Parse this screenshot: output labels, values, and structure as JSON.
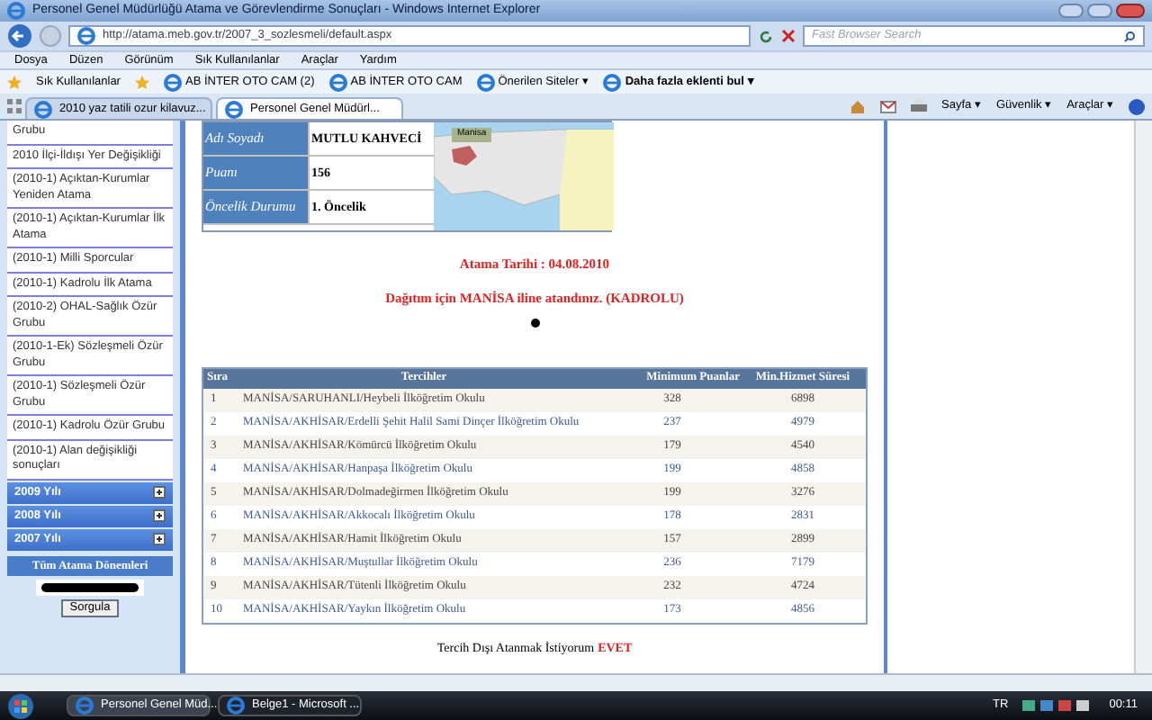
{
  "window": {
    "title": "Personel Genel Müdürlüğü Atama ve Görevlendirme Sonuçları - Windows Internet Explorer"
  },
  "address_bar": {
    "url": "http://atama.meb.gov.tr/2007_3_sozlesmeli/default.aspx"
  },
  "search": {
    "placeholder": "Fast Browser Search"
  },
  "menu": [
    "Dosya",
    "Düzen",
    "Görünüm",
    "Sık Kullanılanlar",
    "Araçlar",
    "Yardım"
  ],
  "favorites_bar": {
    "label": "Sık Kullanılanlar",
    "links": [
      {
        "label": "AB İNTER OTO CAM (2)",
        "kind": "page"
      },
      {
        "label": "AB İNTER OTO CAM",
        "kind": "page"
      },
      {
        "label": "Önerilen Siteler ▾",
        "kind": "page"
      },
      {
        "label": "Daha fazla eklenti bul ▾",
        "kind": "bold"
      }
    ]
  },
  "tabs": [
    {
      "label": "2010 yaz tatili ozur kilavuz...",
      "selected": false
    },
    {
      "label": "Personel Genel Müdürl...",
      "selected": true
    }
  ],
  "command_bar": [
    "Sayfa ▾",
    "Güvenlik ▾",
    "Araçlar ▾"
  ],
  "sidebar": {
    "items": [
      "Grubu",
      "2010 İlçi-İldışı Yer Değişikliği",
      "(2010-1) Açıktan-Kurumlar Yeniden Atama",
      "(2010-1) Açıktan-Kurumlar İlk Atama",
      "(2010-1) Milli Sporcular",
      "(2010-1) Kadrolu İlk Atama",
      "(2010-2) OHAL-Sağlık Özür Grubu",
      "(2010-1-Ek) Sözleşmeli Özür Grubu",
      "(2010-1) Sözleşmeli Özür Grubu",
      "(2010-1) Kadrolu Özür Grubu",
      "(2010-1) Alan değişikliği sonuçları"
    ],
    "years": [
      {
        "label": "2009 Yılı",
        "expanded": false
      },
      {
        "label": "2008 Yılı",
        "expanded": false
      },
      {
        "label": "2007 Yılı",
        "expanded": false
      }
    ],
    "panel": {
      "title": "Tüm Atama Dönemleri",
      "button": "Sorgula"
    }
  },
  "info": [
    {
      "label": "Adı Soyadı",
      "value": "MUTLU KAHVECİ"
    },
    {
      "label": "Puanı",
      "value": "156"
    },
    {
      "label": "Öncelik Durumu",
      "value": "1. Öncelik"
    }
  ],
  "map": {
    "label": "Manisa"
  },
  "assignment": {
    "date": "Atama Tarihi : 04.08.2010",
    "message": "Dağıtım için MANİSA iline atandınız. (KADROLU)"
  },
  "table": {
    "columns": [
      "Sıra",
      "Tercihler",
      "Minimum Puanlar",
      "Min.Hizmet Süresi"
    ],
    "rows": [
      [
        "1",
        "MANİSA/SARUHANLI/Heybeli İlköğretim Okulu",
        "328",
        "6898"
      ],
      [
        "2",
        "MANİSA/AKHİSAR/Erdelli Şehit Halil Sami Dinçer İlköğretim Okulu",
        "237",
        "4979"
      ],
      [
        "3",
        "MANİSA/AKHİSAR/Kömürcü İlköğretim Okulu",
        "179",
        "4540"
      ],
      [
        "4",
        "MANİSA/AKHİSAR/Hanpaşa İlköğretim Okulu",
        "199",
        "4858"
      ],
      [
        "5",
        "MANİSA/AKHİSAR/Dolmadeğirmen İlköğretim Okulu",
        "199",
        "3276"
      ],
      [
        "6",
        "MANİSA/AKHİSAR/Akkocalı İlköğretim Okulu",
        "178",
        "2831"
      ],
      [
        "7",
        "MANİSA/AKHİSAR/Hamit İlköğretim Okulu",
        "157",
        "2899"
      ],
      [
        "8",
        "MANİSA/AKHİSAR/Muştullar İlköğretim Okulu",
        "236",
        "7179"
      ],
      [
        "9",
        "MANİSA/AKHİSAR/Tütenli İlköğretim Okulu",
        "232",
        "4724"
      ],
      [
        "10",
        "MANİSA/AKHİSAR/Yaykın İlköğretim Okulu",
        "173",
        "4856"
      ]
    ]
  },
  "footer": {
    "text": "Tercih Dışı Atanmak İstiyorum",
    "answer": "EVET"
  },
  "taskbar": {
    "items": [
      {
        "label": "Personel Genel Müd...",
        "selected": true
      },
      {
        "label": "Belge1 - Microsoft ...",
        "selected": false
      }
    ],
    "language": "TR",
    "clock": "00:11"
  }
}
